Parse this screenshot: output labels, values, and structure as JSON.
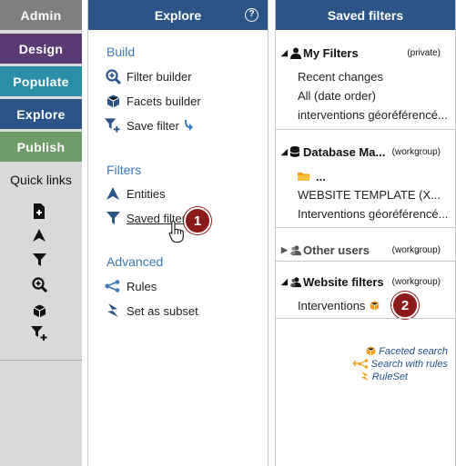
{
  "nav": {
    "admin": "Admin",
    "design": "Design",
    "populate": "Populate",
    "explore": "Explore",
    "publish": "Publish",
    "quick_links_title": "Quick links"
  },
  "explore_panel": {
    "title": "Explore",
    "help": "?",
    "build": {
      "title": "Build",
      "filter_builder": "Filter builder",
      "facets_builder": "Facets builder",
      "save_filter": "Save filter"
    },
    "filters": {
      "title": "Filters",
      "entities": "Entities",
      "saved_filters": "Saved filters"
    },
    "advanced": {
      "title": "Advanced",
      "rules": "Rules",
      "set_as_subset": "Set as subset"
    },
    "badge_1": "1"
  },
  "saved_panel": {
    "title": "Saved filters",
    "my_filters": {
      "label": "My Filters",
      "scope": "(private)",
      "items": [
        "Recent changes",
        "All (date order)",
        "interventions géoréférencé..."
      ]
    },
    "database": {
      "label": "Database Ma...",
      "scope": "(workgroup)",
      "folder": "...",
      "items": [
        "WEBSITE TEMPLATE (X...",
        "Interventions géoréférencé..."
      ]
    },
    "other_users": {
      "label": "Other users",
      "scope": "(workgroup)"
    },
    "website_filters": {
      "label": "Website filters",
      "scope": "(workgroup)",
      "items": [
        "Interventions"
      ]
    },
    "badge_2": "2",
    "legend": {
      "faceted_search": "Faceted search",
      "search_with_rules": "Search with rules",
      "ruleset": "RuleSet"
    }
  },
  "colors": {
    "header_blue": "#2c5486",
    "section_blue": "#3a7ab8",
    "badge_red": "#8b1a1a",
    "legend_orange": "#f0a020"
  }
}
